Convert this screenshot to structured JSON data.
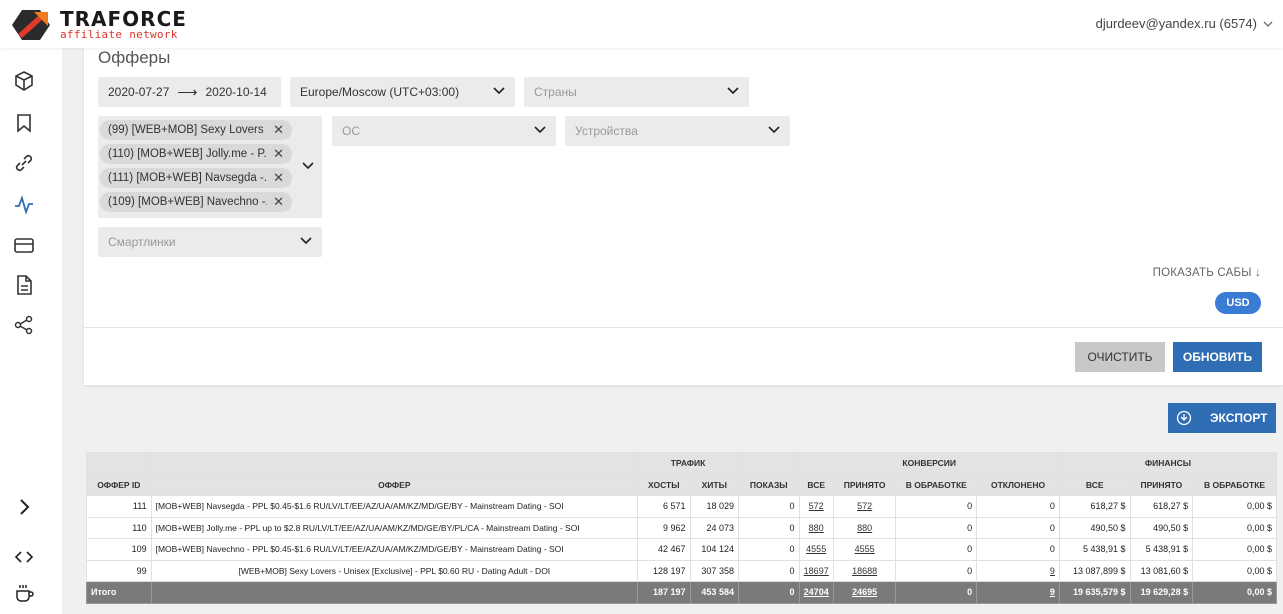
{
  "header": {
    "brand_title": "TRAFORCE",
    "brand_subtitle": "affiliate network",
    "user": "djurdeev@yandex.ru (6574)"
  },
  "sidebar": {
    "items": [
      "package-icon",
      "bookmark-icon",
      "link-icon",
      "activity-icon",
      "card-icon",
      "document-icon",
      "share-icon"
    ],
    "expand": "›",
    "code_icon": "<>"
  },
  "filters": {
    "title": "Офферы",
    "date_from": "2020-07-27",
    "date_arrow": "⟶",
    "date_to": "2020-10-14",
    "timezone": "Europe/Moscow (UTC+03:00)",
    "countries_placeholder": "Страны",
    "os_placeholder": "ОС",
    "devices_placeholder": "Устройства",
    "smartlinks_placeholder": "Смартлинки",
    "offers_selected": [
      "(99) [WEB+MOB] Sexy Lovers ...",
      "(110) [MOB+WEB] Jolly.me - P...",
      "(111) [MOB+WEB] Navsegda -...",
      "(109) [MOB+WEB] Navechno -..."
    ],
    "chip_remove": "✕",
    "show_subs": "ПОКАЗАТЬ САБЫ ↓",
    "currency": "USD",
    "clear_label": "ОЧИСТИТЬ",
    "update_label": "ОБНОВИТЬ"
  },
  "export_label": "ЭКСПОРТ",
  "table": {
    "group_headers": {
      "traffic": "ТРАФИК",
      "conversions": "КОНВЕРСИИ",
      "finance": "ФИНАНСЫ"
    },
    "columns": [
      "ОФФЕР ID",
      "ОФФЕР",
      "ХОСТЫ",
      "ХИТЫ",
      "ПОКАЗЫ",
      "ВСЕ",
      "ПРИНЯТО",
      "В ОБРАБОТКЕ",
      "ОТКЛОНЕНО",
      "ВСЕ",
      "ПРИНЯТО",
      "В ОБРАБОТКЕ"
    ],
    "rows": [
      {
        "id": "111",
        "offer": "[MOB+WEB] Navsegda - PPL $0.45-$1.6 RU/LV/LT/EE/AZ/UA/AM/KZ/MD/GE/BY - Mainstream Dating - SOI",
        "hosts": "6 571",
        "hits": "18 029",
        "shows": "0",
        "conv_all": "572",
        "conv_accepted": "572",
        "conv_pending": "0",
        "conv_rejected": "0",
        "fin_all": "618,27 $",
        "fin_accepted": "618,27 $",
        "fin_pending": "0,00 $"
      },
      {
        "id": "110",
        "offer": "[MOB+WEB] Jolly.me - PPL up to $2.8 RU/LV/LT/EE/AZ/UA/AM/KZ/MD/GE/BY/PL/CA - Mainstream Dating - SOI",
        "hosts": "9 962",
        "hits": "24 073",
        "shows": "0",
        "conv_all": "880",
        "conv_accepted": "880",
        "conv_pending": "0",
        "conv_rejected": "0",
        "fin_all": "490,50 $",
        "fin_accepted": "490,50 $",
        "fin_pending": "0,00 $"
      },
      {
        "id": "109",
        "offer": "[MOB+WEB] Navechno - PPL $0.45-$1.6 RU/LV/LT/EE/AZ/UA/AM/KZ/MD/GE/BY - Mainstream Dating - SOI",
        "hosts": "42 467",
        "hits": "104 124",
        "shows": "0",
        "conv_all": "4555",
        "conv_accepted": "4555",
        "conv_pending": "0",
        "conv_rejected": "0",
        "fin_all": "5 438,91 $",
        "fin_accepted": "5 438,91 $",
        "fin_pending": "0,00 $"
      },
      {
        "id": "99",
        "offer": "[WEB+MOB] Sexy Lovers - Unisex [Exclusive] - PPL $0.60 RU - Dating Adult - DOI",
        "hosts": "128 197",
        "hits": "307 358",
        "shows": "0",
        "conv_all": "18697",
        "conv_accepted": "18688",
        "conv_pending": "0",
        "conv_rejected": "9",
        "fin_all": "13 087,899 $",
        "fin_accepted": "13 081,60 $",
        "fin_pending": "0,00 $"
      }
    ],
    "total": {
      "label": "Итого",
      "hosts": "187 197",
      "hits": "453 584",
      "shows": "0",
      "conv_all": "24704",
      "conv_accepted": "24695",
      "conv_pending": "0",
      "conv_rejected": "9",
      "fin_all": "19 635,579 $",
      "fin_accepted": "19 629,28 $",
      "fin_pending": "0,00 $"
    }
  }
}
